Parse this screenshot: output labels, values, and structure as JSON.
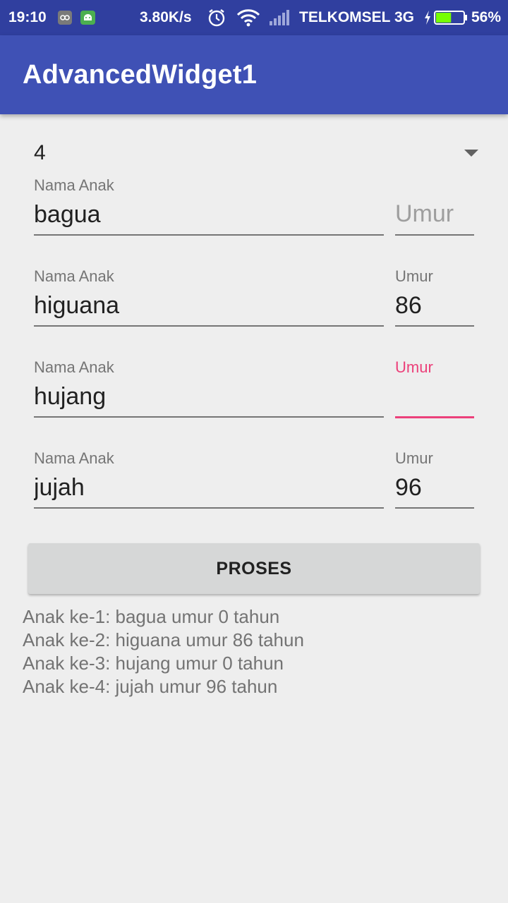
{
  "status_bar": {
    "time": "19:10",
    "network_speed": "3.80K/s",
    "carrier": "TELKOMSEL 3G",
    "battery_percent": "56%",
    "battery_level": 0.56,
    "icons": [
      "app-notification-icon",
      "android-notification-icon",
      "alarm-icon",
      "wifi-icon",
      "signal-icon",
      "charging-bolt-icon",
      "battery-icon"
    ]
  },
  "app_bar": {
    "title": "AdvancedWidget1"
  },
  "spinner": {
    "selected": "4"
  },
  "rows": [
    {
      "name_label": "Nama Anak",
      "name_value": "bagua",
      "age_label": "",
      "age_placeholder": "Umur",
      "age_value": ""
    },
    {
      "name_label": "Nama Anak",
      "name_value": "higuana",
      "age_label": "Umur",
      "age_value": "86"
    },
    {
      "name_label": "Nama Anak",
      "name_value": "hujang",
      "age_label": "Umur",
      "age_value": ""
    },
    {
      "name_label": "Nama Anak",
      "name_value": "jujah",
      "age_label": "Umur",
      "age_value": "96"
    }
  ],
  "button": {
    "label": "PROSES"
  },
  "output": [
    "Anak ke-1: bagua umur 0 tahun",
    "Anak ke-2: higuana umur 86 tahun",
    "Anak ke-3: hujang umur 0 tahun",
    "Anak ke-4: jujah umur 96 tahun"
  ],
  "colors": {
    "status_bar": "#303f9f",
    "app_bar": "#3f51b5",
    "accent": "#ec407a",
    "background": "#eeeeee",
    "button": "#d6d7d7"
  }
}
